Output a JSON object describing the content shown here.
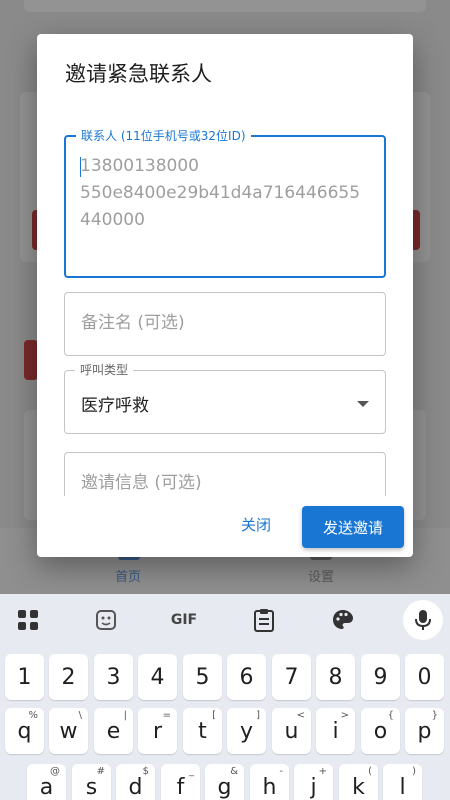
{
  "dialog": {
    "title": "邀请紧急联系人",
    "contact_field": {
      "label": "联系人 (11位手机号或32位ID)",
      "placeholder_lines": [
        "13800138000",
        "550e8400e29b41d4a716446655",
        "440000"
      ]
    },
    "note_field": {
      "placeholder": "备注名 (可选)"
    },
    "call_type_field": {
      "label": "呼叫类型",
      "value": "医疗呼救"
    },
    "invite_field": {
      "placeholder": "邀请信息 (可选)"
    },
    "actions": {
      "close": "关闭",
      "send": "发送邀请"
    }
  },
  "bottom_nav": {
    "home": "首页",
    "settings": "设置"
  },
  "keyboard": {
    "toolbar": {
      "gif": "GIF"
    },
    "number_row": [
      "1",
      "2",
      "3",
      "4",
      "5",
      "6",
      "7",
      "8",
      "9",
      "0"
    ],
    "q_row": [
      {
        "key": "q",
        "hint": "%"
      },
      {
        "key": "w",
        "hint": "\\"
      },
      {
        "key": "e",
        "hint": "|"
      },
      {
        "key": "r",
        "hint": "="
      },
      {
        "key": "t",
        "hint": "["
      },
      {
        "key": "y",
        "hint": "]"
      },
      {
        "key": "u",
        "hint": "<"
      },
      {
        "key": "i",
        "hint": ">"
      },
      {
        "key": "o",
        "hint": "{"
      },
      {
        "key": "p",
        "hint": "}"
      }
    ],
    "a_row": [
      {
        "key": "a",
        "hint": "@"
      },
      {
        "key": "s",
        "hint": "#"
      },
      {
        "key": "d",
        "hint": "$"
      },
      {
        "key": "f",
        "hint": "_"
      },
      {
        "key": "g",
        "hint": "&"
      },
      {
        "key": "h",
        "hint": "-"
      },
      {
        "key": "j",
        "hint": "+"
      },
      {
        "key": "k",
        "hint": "("
      },
      {
        "key": "l",
        "hint": ")"
      }
    ]
  },
  "colors": {
    "accent": "#1976d2",
    "dialog_bg": "#ffffff",
    "keyboard_bg": "#e8eaf2"
  }
}
